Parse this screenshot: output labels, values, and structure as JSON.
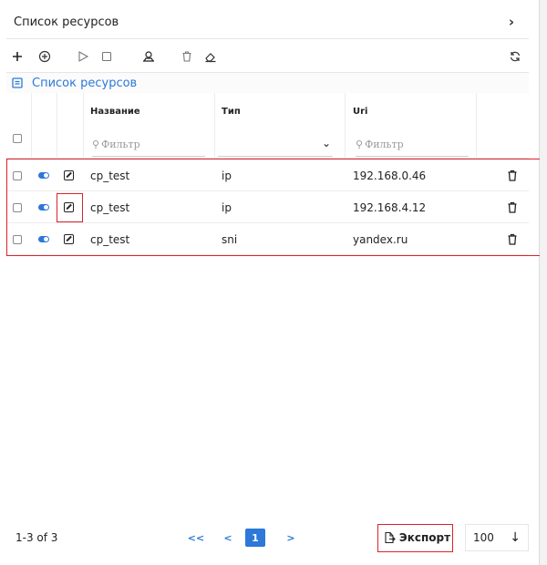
{
  "header": {
    "title": "Список ресурсов",
    "expand_icon": "chevron-right-icon"
  },
  "toolbar": {
    "buttons": [
      {
        "icon": "plus-icon"
      },
      {
        "icon": "add-circle-icon"
      },
      {
        "icon": "play-icon"
      },
      {
        "icon": "stop-icon"
      },
      {
        "icon": "hand-coin-icon"
      },
      {
        "icon": "trash-icon"
      },
      {
        "icon": "eraser-icon"
      },
      {
        "icon": "refresh-icon"
      }
    ]
  },
  "breadcrumb": {
    "label": "Список ресурсов",
    "icon": "document-icon"
  },
  "table": {
    "columns": [
      "Название",
      "Тип",
      "Uri"
    ],
    "filter_placeholder": "Фильтр",
    "rows": [
      {
        "name": "cp_test",
        "type": "ip",
        "uri": "192.168.0.46"
      },
      {
        "name": "cp_test",
        "type": "ip",
        "uri": "192.168.4.12"
      },
      {
        "name": "cp_test",
        "type": "sni",
        "uri": "yandex.ru"
      }
    ]
  },
  "footer": {
    "count": "1-3 of 3",
    "first_label": "<<",
    "prev_label": "<",
    "current_page": "1",
    "next_label": ">",
    "export_label": "Экспорт",
    "page_size": "100"
  },
  "colors": {
    "accent": "#2d78d8",
    "highlight": "#d9232d"
  }
}
